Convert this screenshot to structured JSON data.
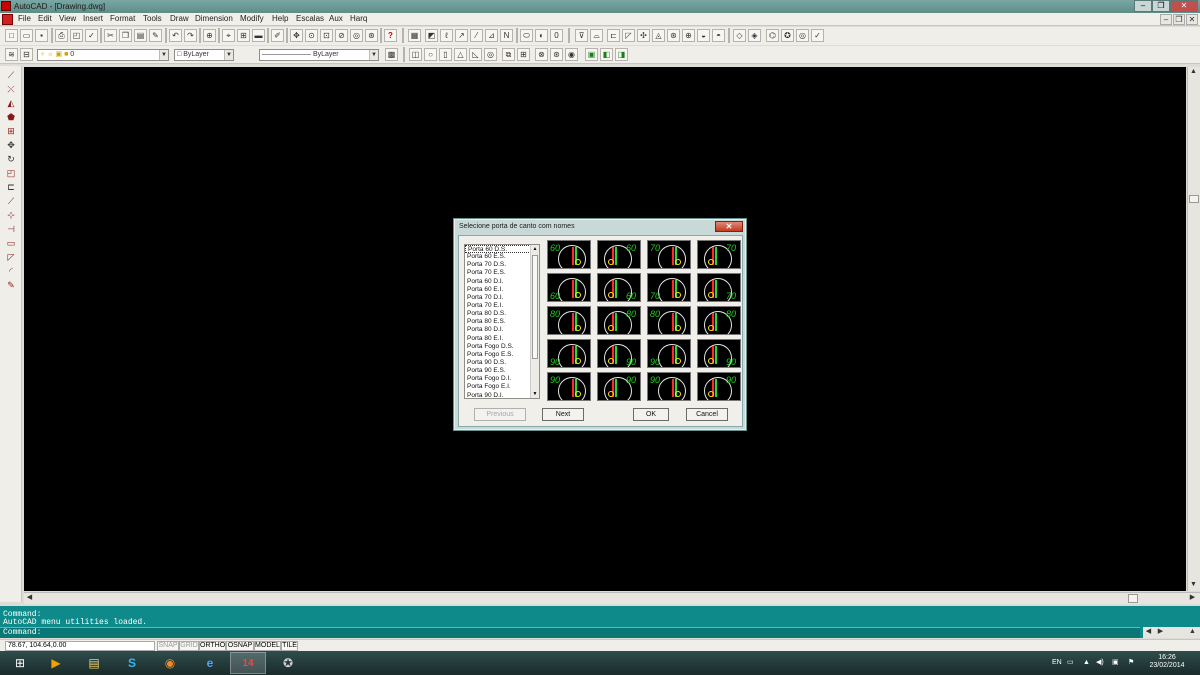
{
  "window": {
    "title": "AutoCAD - [Drawing.dwg]",
    "controls": [
      "–",
      "❐",
      "✕"
    ]
  },
  "menubar": {
    "items": [
      "File",
      "Edit",
      "View",
      "Insert",
      "Format",
      "Tools",
      "Draw",
      "Dimension",
      "Modify",
      "Help",
      "Escalas",
      "Aux",
      "Harq"
    ],
    "mdi_controls": [
      "–",
      "❐",
      "✕"
    ]
  },
  "layer_toolbar": {
    "layer_value": "0",
    "color_value": "ByLayer",
    "linetype_value": "ByLayer"
  },
  "command": {
    "lines": [
      "Command:",
      "AutoCAD menu utilities loaded.",
      "Command:"
    ]
  },
  "statusbar": {
    "coords": "78.67, 104.64,0.00",
    "modes": [
      {
        "label": "SNAP",
        "on": false
      },
      {
        "label": "GRID",
        "on": false
      },
      {
        "label": "ORTHO",
        "on": true
      },
      {
        "label": "OSNAP",
        "on": true
      },
      {
        "label": "MODEL",
        "on": true
      },
      {
        "label": "TILE",
        "on": true
      }
    ]
  },
  "taskbar": {
    "lang": "EN",
    "time": "16:26",
    "date": "23/02/2014",
    "apps": [
      "windows-start",
      "media-player",
      "file-explorer",
      "skype",
      "firefox",
      "internet-explorer",
      "autocad-14",
      "autocad-app"
    ]
  },
  "dialog": {
    "title": "Selecione porta de canto com nomes",
    "close": "✕",
    "list_items": [
      "Porta 60 D.S.",
      "Porta 60 E.S.",
      "Porta 70 D.S.",
      "Porta 70 E.S.",
      "Porta 60 D.I.",
      "Porta 60 E.I.",
      "Porta 70 D.I.",
      "Porta 70 E.I.",
      "Porta 80 D.S.",
      "Porta 80 E.S.",
      "Porta 80 D.I.",
      "Porta 80 E.I.",
      "Porta Fogo D.S.",
      "Porta Fogo E.S.",
      "Porta 90 D.S.",
      "Porta 90 E.S.",
      "Porta Fogo D.I.",
      "Porta Fogo E.I.",
      "Porta 90 D.I."
    ],
    "selected_index": 0,
    "tiles": [
      {
        "num": "60",
        "side": "left"
      },
      {
        "num": "60",
        "side": "right"
      },
      {
        "num": "70",
        "side": "left"
      },
      {
        "num": "70",
        "side": "right"
      },
      {
        "num": "60",
        "side": "left"
      },
      {
        "num": "60",
        "side": "right"
      },
      {
        "num": "70",
        "side": "left"
      },
      {
        "num": "70",
        "side": "right"
      },
      {
        "num": "80",
        "side": "left"
      },
      {
        "num": "80",
        "side": "right"
      },
      {
        "num": "80",
        "side": "left"
      },
      {
        "num": "80",
        "side": "right"
      },
      {
        "num": "90",
        "side": "left"
      },
      {
        "num": "90",
        "side": "right"
      },
      {
        "num": "90",
        "side": "left"
      },
      {
        "num": "90",
        "side": "right"
      },
      {
        "num": "90",
        "side": "left"
      },
      {
        "num": "90",
        "side": "right"
      },
      {
        "num": "90",
        "side": "left"
      },
      {
        "num": "90",
        "side": "right"
      }
    ],
    "buttons": {
      "previous": "Previous",
      "next": "Next",
      "ok": "OK",
      "cancel": "Cancel"
    }
  }
}
